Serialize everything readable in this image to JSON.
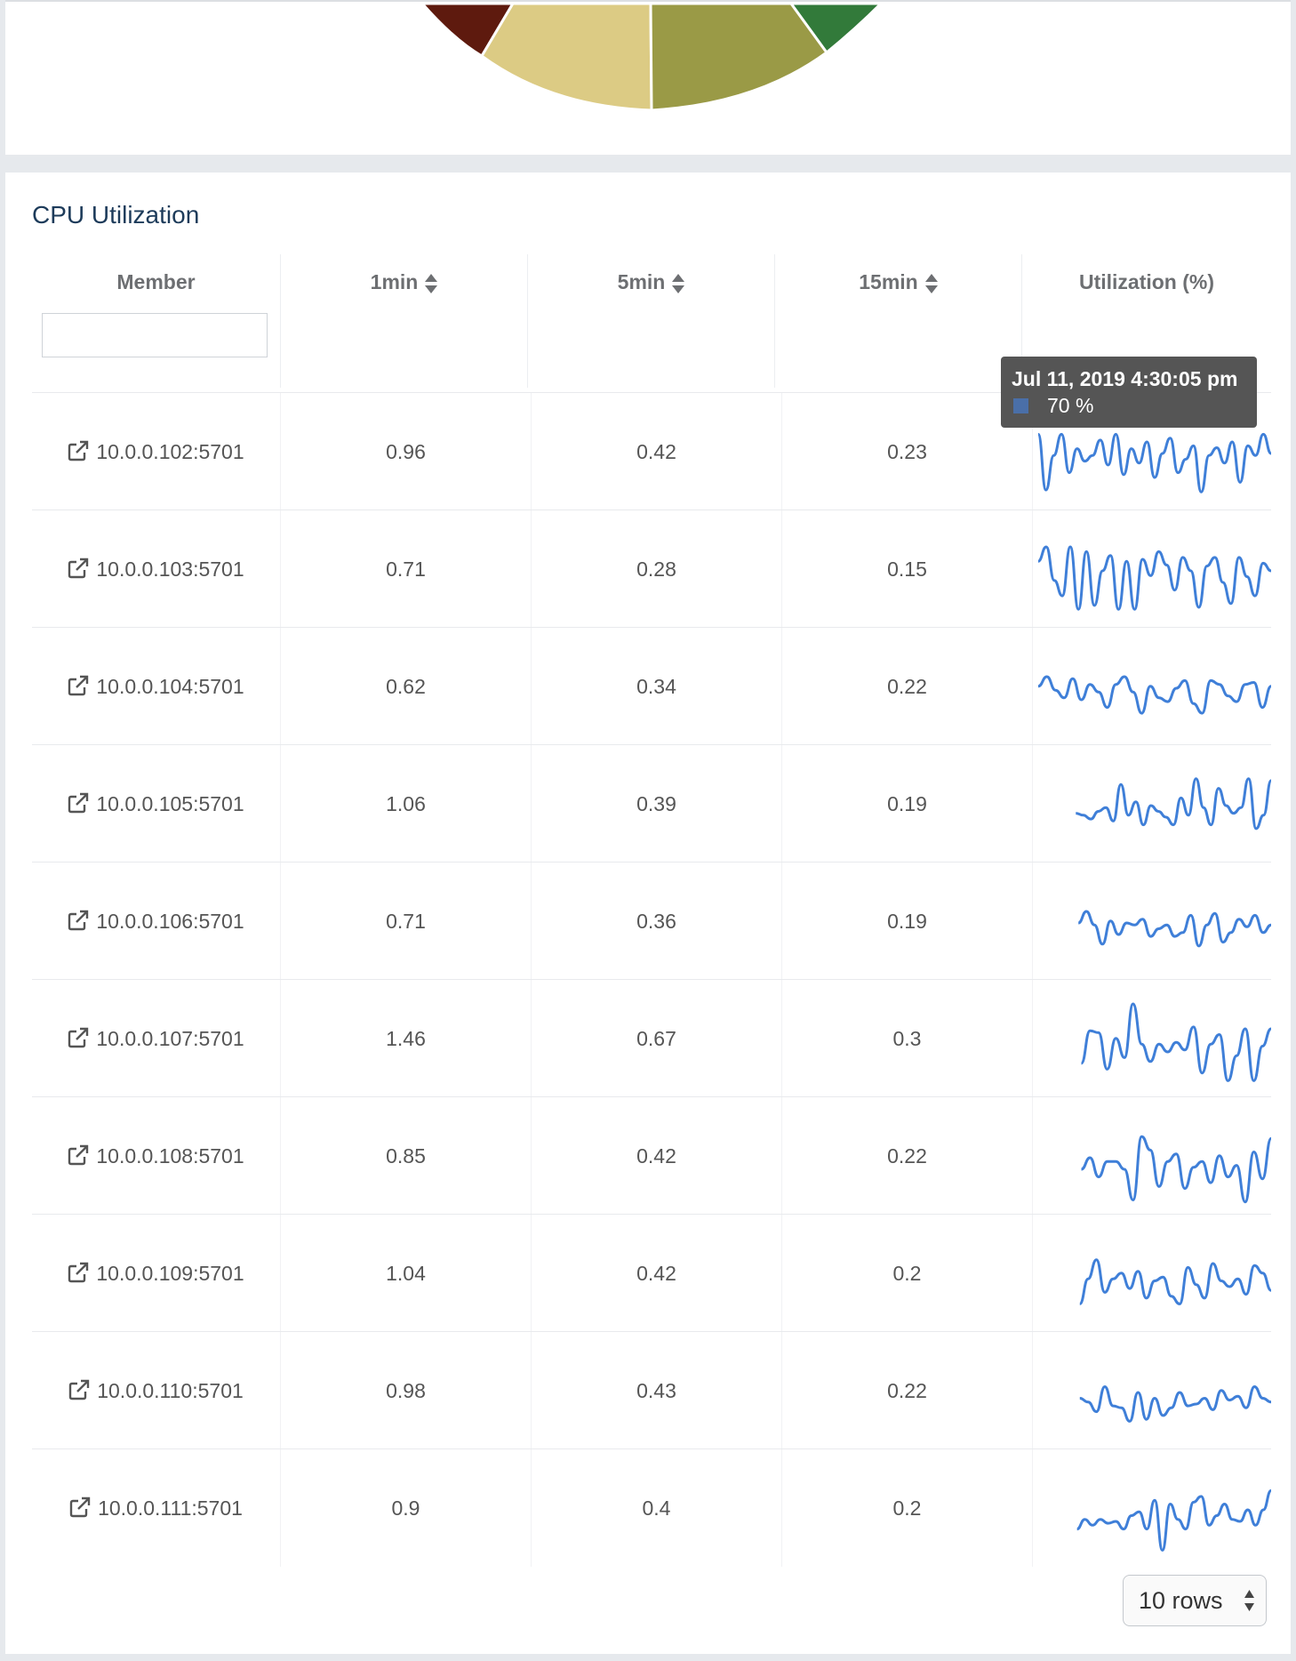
{
  "panel": {
    "title": "CPU Utilization"
  },
  "columns": [
    {
      "label": "Member",
      "sortable": false
    },
    {
      "label": "1min",
      "sortable": true
    },
    {
      "label": "5min",
      "sortable": true
    },
    {
      "label": "15min",
      "sortable": true
    },
    {
      "label": "Utilization (%)",
      "sortable": false
    }
  ],
  "filter": {
    "value": ""
  },
  "rows": [
    {
      "member": "10.0.0.102:5701",
      "m1": "0.96",
      "m5": "0.42",
      "m15": "0.23"
    },
    {
      "member": "10.0.0.103:5701",
      "m1": "0.71",
      "m5": "0.28",
      "m15": "0.15"
    },
    {
      "member": "10.0.0.104:5701",
      "m1": "0.62",
      "m5": "0.34",
      "m15": "0.22"
    },
    {
      "member": "10.0.0.105:5701",
      "m1": "1.06",
      "m5": "0.39",
      "m15": "0.19"
    },
    {
      "member": "10.0.0.106:5701",
      "m1": "0.71",
      "m5": "0.36",
      "m15": "0.19"
    },
    {
      "member": "10.0.0.107:5701",
      "m1": "1.46",
      "m5": "0.67",
      "m15": "0.3"
    },
    {
      "member": "10.0.0.108:5701",
      "m1": "0.85",
      "m5": "0.42",
      "m15": "0.22"
    },
    {
      "member": "10.0.0.109:5701",
      "m1": "1.04",
      "m5": "0.42",
      "m15": "0.2"
    },
    {
      "member": "10.0.0.110:5701",
      "m1": "0.98",
      "m5": "0.43",
      "m15": "0.22"
    },
    {
      "member": "10.0.0.111:5701",
      "m1": "0.9",
      "m5": "0.4",
      "m15": "0.2"
    }
  ],
  "sparklines": [
    [
      70,
      12,
      48,
      70,
      30,
      55,
      42,
      48,
      64,
      38,
      70,
      28,
      55,
      40,
      62,
      25,
      50,
      66,
      30,
      44,
      58,
      10,
      48,
      56,
      40,
      62,
      20,
      58,
      48,
      70,
      50
    ],
    [
      60,
      75,
      40,
      24,
      75,
      10,
      70,
      14,
      50,
      66,
      10,
      60,
      10,
      62,
      45,
      70,
      56,
      30,
      64,
      50,
      12,
      55,
      64,
      38,
      16,
      64,
      44,
      24,
      58,
      50
    ],
    [
      52,
      62,
      48,
      40,
      60,
      38,
      54,
      46,
      30,
      54,
      62,
      46,
      24,
      52,
      40,
      36,
      50,
      58,
      34,
      24,
      58,
      54,
      42,
      36,
      54,
      56,
      30,
      52
    ],
    [
      0,
      0,
      0,
      0,
      0,
      42,
      40,
      36,
      44,
      48,
      34,
      72,
      40,
      54,
      30,
      50,
      44,
      38,
      30,
      58,
      40,
      78,
      48,
      30,
      68,
      50,
      42,
      48,
      78,
      26,
      40,
      76
    ],
    [
      0,
      0,
      0,
      0,
      0,
      50,
      62,
      48,
      28,
      52,
      38,
      50,
      48,
      54,
      36,
      44,
      48,
      36,
      40,
      58,
      26,
      48,
      60,
      30,
      40,
      54,
      46,
      58,
      40,
      48
    ],
    [
      0,
      0,
      0,
      0,
      0,
      26,
      60,
      58,
      20,
      52,
      32,
      88,
      46,
      28,
      46,
      38,
      48,
      40,
      64,
      16,
      46,
      56,
      8,
      34,
      62,
      8,
      44,
      62
    ],
    [
      0,
      0,
      0,
      0,
      0,
      38,
      50,
      30,
      46,
      46,
      38,
      6,
      72,
      58,
      20,
      46,
      54,
      18,
      40,
      46,
      24,
      52,
      30,
      42,
      4,
      56,
      28,
      70
    ],
    [
      0,
      0,
      0,
      0,
      0,
      20,
      46,
      66,
      32,
      46,
      52,
      36,
      54,
      26,
      44,
      48,
      28,
      20,
      58,
      40,
      26,
      62,
      44,
      38,
      46,
      30,
      60,
      52,
      34
    ],
    [
      0,
      0,
      0,
      0,
      0,
      44,
      40,
      30,
      56,
      36,
      34,
      20,
      50,
      22,
      44,
      26,
      34,
      50,
      36,
      38,
      44,
      32,
      52,
      42,
      46,
      34,
      56,
      44,
      40
    ],
    [
      0,
      0,
      0,
      0,
      0,
      30,
      40,
      34,
      40,
      36,
      38,
      30,
      44,
      48,
      30,
      60,
      8,
      56,
      40,
      30,
      58,
      64,
      34,
      44,
      56,
      40,
      38,
      50,
      34,
      50,
      70
    ]
  ],
  "tooltip": {
    "time": "Jul 11, 2019 4:30:05 pm",
    "value": "70 %",
    "swatch_color": "#4a6fa8"
  },
  "pagination": {
    "rows_label": "10 rows"
  },
  "colors": {
    "sparkline": "#3f7fd8",
    "pie_slices": [
      "#5e1a0e",
      "#dccb84",
      "#9a9a46",
      "#327a3a"
    ]
  }
}
